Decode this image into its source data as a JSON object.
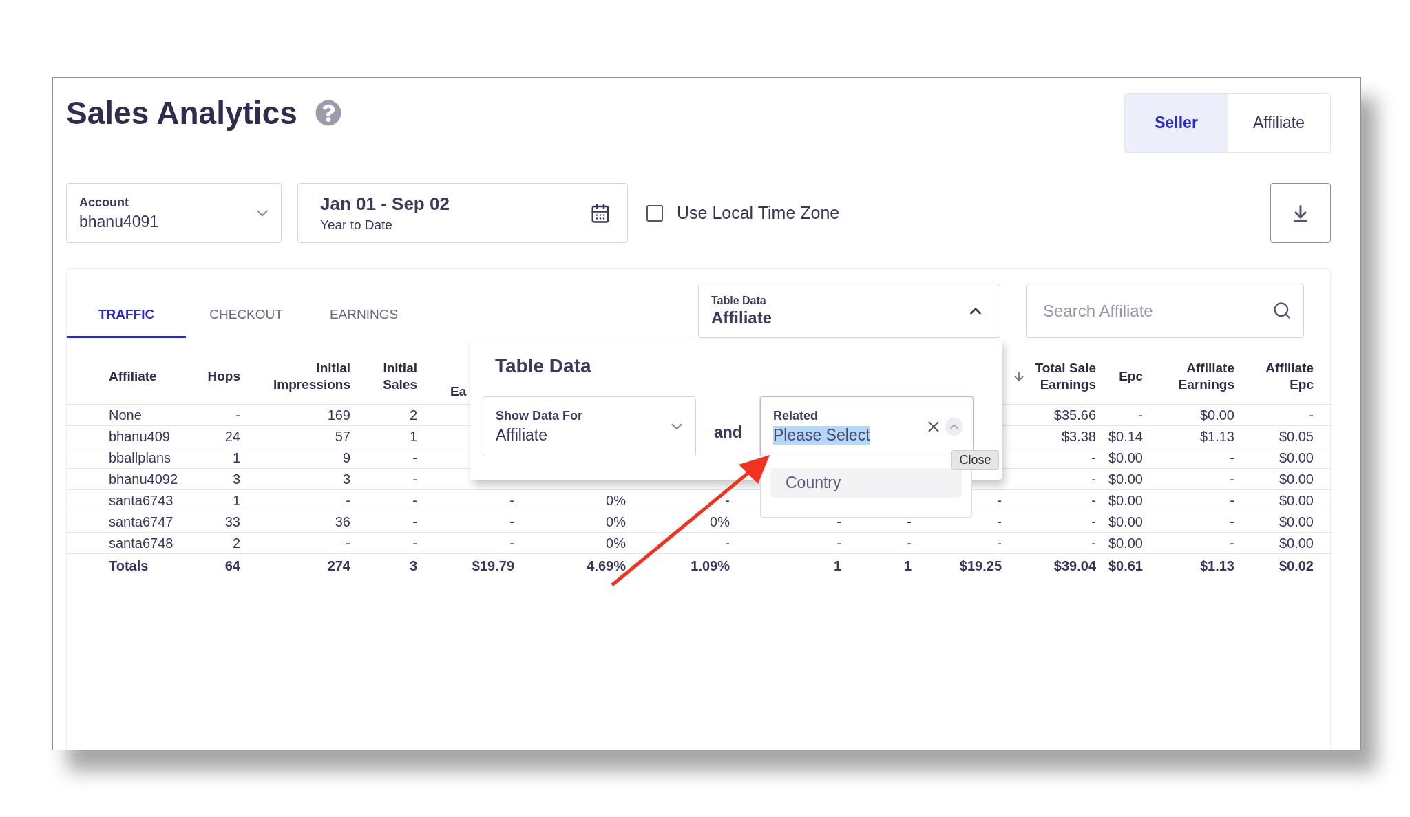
{
  "title": "Sales Analytics",
  "view_toggle": [
    {
      "label": "Seller",
      "selected": true
    },
    {
      "label": "Affiliate",
      "selected": false
    }
  ],
  "account": {
    "label": "Account",
    "value": "bhanu4091"
  },
  "date_range": {
    "value": "Jan 01 - Sep 02",
    "subtitle": "Year to Date"
  },
  "local_time_zone": {
    "label": "Use Local Time Zone",
    "checked": false
  },
  "tabs": [
    {
      "label": "TRAFFIC",
      "selected": true
    },
    {
      "label": "CHECKOUT",
      "selected": false
    },
    {
      "label": "EARNINGS",
      "selected": false
    }
  ],
  "table_data_select": {
    "label": "Table Data",
    "value": "Affiliate",
    "expanded": true
  },
  "search": {
    "placeholder": "Search Affiliate"
  },
  "table": {
    "columns": [
      {
        "label": "Affiliate",
        "sorted": false
      },
      {
        "label": "Hops",
        "sorted": false
      },
      {
        "label": "Initial\nImpressions",
        "sorted": false
      },
      {
        "label": "Initial\nSales",
        "sorted": false
      },
      {
        "label": "Ea",
        "sorted": false
      },
      null,
      null,
      null,
      null,
      null,
      {
        "label": "Total Sale\nEarnings",
        "sorted": true
      },
      {
        "label": "Epc",
        "sorted": false
      },
      {
        "label": "Affiliate\nEarnings",
        "sorted": false
      },
      {
        "label": "Affiliate\nEpc",
        "sorted": false
      }
    ],
    "rows": [
      [
        "None",
        "-",
        "169",
        "2",
        null,
        null,
        null,
        null,
        null,
        null,
        "$35.66",
        "-",
        "$0.00",
        "-"
      ],
      [
        "bhanu409",
        "24",
        "57",
        "1",
        null,
        null,
        null,
        null,
        null,
        null,
        "$3.38",
        "$0.14",
        "$1.13",
        "$0.05"
      ],
      [
        "bballplans",
        "1",
        "9",
        "-",
        null,
        null,
        null,
        null,
        null,
        null,
        "-",
        "$0.00",
        "-",
        "$0.00"
      ],
      [
        "bhanu4092",
        "3",
        "3",
        "-",
        null,
        null,
        null,
        null,
        null,
        null,
        "-",
        "$0.00",
        "-",
        "$0.00"
      ],
      [
        "santa6743",
        "1",
        "-",
        "-",
        "-",
        "0%",
        "-",
        null,
        null,
        "-",
        "-",
        "$0.00",
        "-",
        "$0.00"
      ],
      [
        "santa6747",
        "33",
        "36",
        "-",
        "-",
        "0%",
        "0%",
        "-",
        "-",
        "-",
        "-",
        "$0.00",
        "-",
        "$0.00"
      ],
      [
        "santa6748",
        "2",
        "-",
        "-",
        "-",
        "0%",
        "-",
        "-",
        "-",
        "-",
        "-",
        "$0.00",
        "-",
        "$0.00"
      ]
    ],
    "totals": [
      "Totals",
      "64",
      "274",
      "3",
      "$19.79",
      "4.69%",
      "1.09%",
      "1",
      "1",
      "$19.25",
      "$39.04",
      "$0.61",
      "$1.13",
      "$0.02"
    ]
  },
  "popup": {
    "title": "Table Data",
    "show_data_for": {
      "label": "Show Data For",
      "value": "Affiliate"
    },
    "conjunction": "and",
    "related": {
      "label": "Related",
      "value": "Please Select",
      "text_selected": true,
      "expanded": true
    },
    "options": [
      "Country"
    ],
    "tooltip": "Close"
  }
}
